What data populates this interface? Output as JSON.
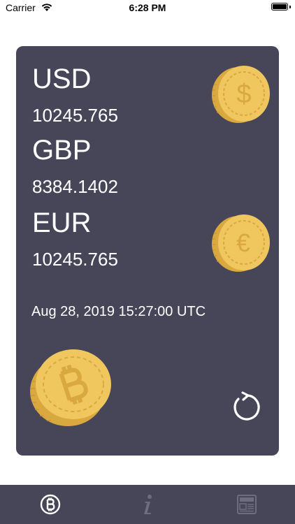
{
  "status_bar": {
    "carrier": "Carrier",
    "time": "6:28 PM"
  },
  "rates": [
    {
      "code": "USD",
      "value": "10245.765",
      "coin_icon": "dollar-coin-icon"
    },
    {
      "code": "GBP",
      "value": "8384.1402"
    },
    {
      "code": "EUR",
      "value": "10245.765",
      "coin_icon": "euro-coin-icon"
    }
  ],
  "timestamp": "Aug 28, 2019 15:27:00 UTC",
  "decorations": {
    "bitcoin_coin_icon": "bitcoin-coin-icon",
    "refresh_icon": "refresh-icon"
  },
  "tab_bar": {
    "tabs": [
      {
        "name": "bitcoin",
        "icon": "bitcoin-tab-icon",
        "active": true
      },
      {
        "name": "info",
        "icon": "info-tab-icon",
        "active": false
      },
      {
        "name": "news",
        "icon": "news-tab-icon",
        "active": false
      }
    ]
  },
  "colors": {
    "card_background": "#474659",
    "coin_gold": "#F0C75E",
    "coin_dark": "#D9A83E",
    "text": "#FFFFFF",
    "tab_inactive": "#6E6D80"
  }
}
